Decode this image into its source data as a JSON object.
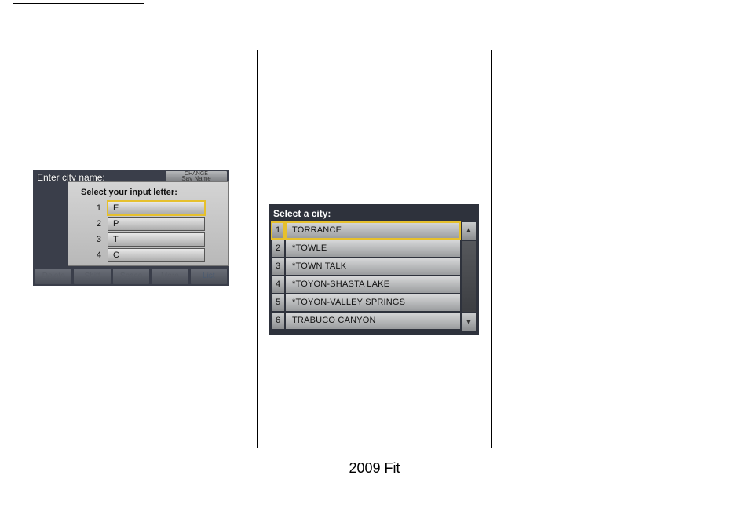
{
  "footer": "2009  Fit",
  "shot1": {
    "bg_label": "Enter city name:",
    "change_line1": "CHANGE",
    "change_line2": "Say Name",
    "popup_title": "Select your input letter:",
    "rows": [
      {
        "n": "1",
        "v": "E"
      },
      {
        "n": "2",
        "v": "P"
      },
      {
        "n": "3",
        "v": "T"
      },
      {
        "n": "4",
        "v": "C"
      }
    ],
    "bottom": [
      "Delete",
      "Shift",
      "Space",
      "More",
      "List"
    ]
  },
  "shot2": {
    "title": "Select a city:",
    "rows": [
      {
        "n": "1",
        "v": "  TORRANCE"
      },
      {
        "n": "2",
        "v": "*TOWLE"
      },
      {
        "n": "3",
        "v": "*TOWN TALK"
      },
      {
        "n": "4",
        "v": "*TOYON-SHASTA LAKE"
      },
      {
        "n": "5",
        "v": "*TOYON-VALLEY SPRINGS"
      },
      {
        "n": "6",
        "v": "  TRABUCO CANYON"
      }
    ],
    "arrow_up": "▲",
    "arrow_down": "▼"
  }
}
